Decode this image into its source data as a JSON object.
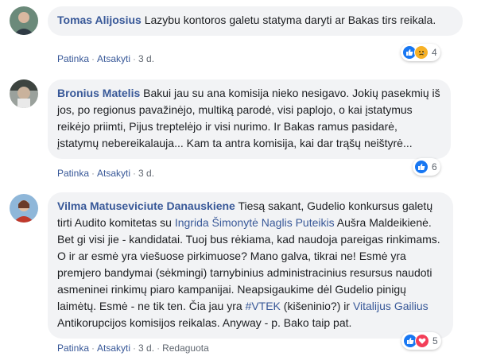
{
  "comments": [
    {
      "author": "Tomas Alijosius",
      "text": "Lazybu kontoros galetu statyma daryti ar Bakas tirs reikala.",
      "like": "Patinka",
      "reply": "Atsakyti",
      "time": "3 d.",
      "reaction_count": "4",
      "reactions": [
        "like-icon",
        "sad-icon"
      ]
    },
    {
      "author": "Bronius Matelis",
      "text": "Bakui jau su ana komisija nieko nesigavo. Jokių pasekmių iš jos, po regionus pavažinėjo, multiką parodė, visi paplojo, o kai įstatymus reikėjo priimti, Pijus treptelėjo ir visi nurimo. Ir Bakas ramus pasidarė, įstatymų nebereikalauja... Kam ta antra komisija, kai dar trąšų neištyrė...",
      "like": "Patinka",
      "reply": "Atsakyti",
      "time": "3 d.",
      "reaction_count": "6",
      "reactions": [
        "like-icon"
      ]
    },
    {
      "author": "Vilma Matuseviciute Danauskiene",
      "text_1": "Tiesą sakant, Gudelio konkursus galetų tirti Audito komitetas su",
      "tags_1": "Ingrida Šimonytė Naglis Puteikis",
      "text_2": "Aušra Maldeikienė. Bet gi visi jie - kandidatai. Tuoj bus rėkiama, kad naudoja pareigas rinkimams. O ir ar esmė yra viešuose pirkimuose? Mano galva, tikrai ne! Esmė yra premjero bandymai (sėkmingi) tarnybinius administracinius resursus naudoti asmeninei rinkimų piaro kampanijai. Neapsigaukime dėl Gudelio pinigų laimėtų. Esmė - ne tik ten. Čia jau yra",
      "tag_2": "#VTEK",
      "text_3": "(kišeninio?) ir",
      "tag_3": "Vitalijus Gailius",
      "text_4": "Antikorupcijos komisijos reikalas. Anyway - p. Bako taip pat.",
      "like": "Patinka",
      "reply": "Atsakyti",
      "time": "3 d.",
      "edited": "Redaguota",
      "reaction_count": "5",
      "reactions": [
        "like-icon",
        "love-icon"
      ]
    }
  ],
  "colors": {
    "link": "#385898",
    "bubble": "#f2f3f5",
    "like": "#1877f2",
    "love": "#f33e58",
    "sad": "#f7b125"
  }
}
